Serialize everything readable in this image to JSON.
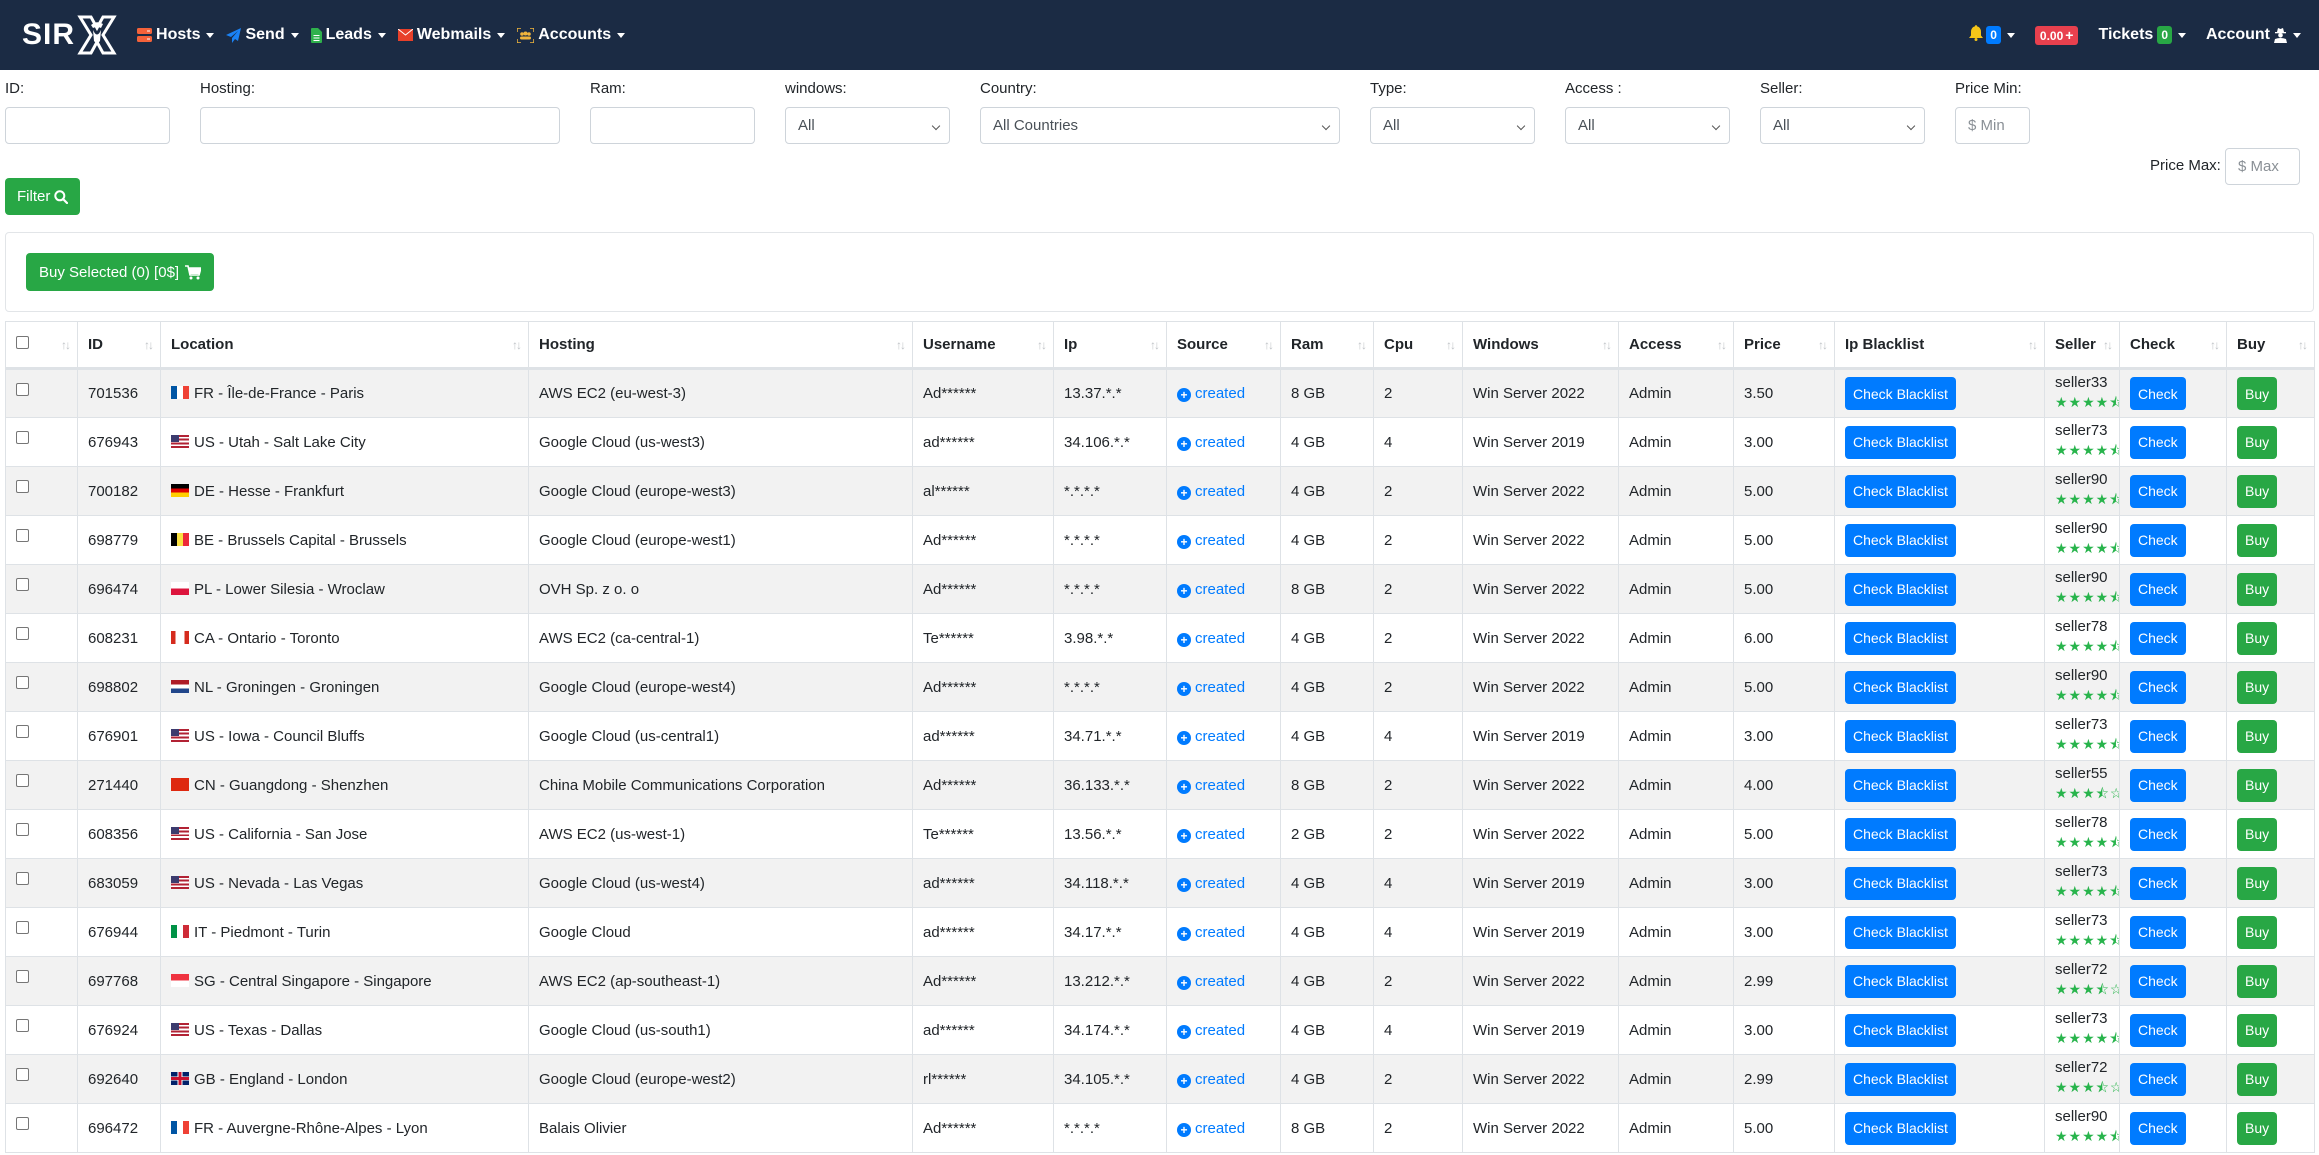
{
  "navbar": {
    "brand": "SIR",
    "menu": [
      {
        "label": "Hosts",
        "icon": "server-icon",
        "color": "#f4623a"
      },
      {
        "label": "Send",
        "icon": "paper-plane-icon",
        "color": "#1a82f5"
      },
      {
        "label": "Leads",
        "icon": "document-icon",
        "color": "#2fb14c"
      },
      {
        "label": "Webmails",
        "icon": "envelope-icon",
        "color": "#e8402a"
      },
      {
        "label": "Accounts",
        "icon": "users-icon",
        "color": "#f0b43c"
      }
    ],
    "notifications_count": "0",
    "balance": "0.00",
    "tickets_label": "Tickets",
    "tickets_count": "0",
    "account_label": "Account"
  },
  "filters": {
    "id": {
      "label": "ID:",
      "value": ""
    },
    "hosting": {
      "label": "Hosting:",
      "value": ""
    },
    "ram": {
      "label": "Ram:",
      "value": ""
    },
    "windows": {
      "label": "windows:",
      "selected": "All"
    },
    "country": {
      "label": "Country:",
      "selected": "All Countries"
    },
    "type": {
      "label": "Type:",
      "selected": "All"
    },
    "access": {
      "label": "Access :",
      "selected": "All"
    },
    "seller": {
      "label": "Seller:",
      "selected": "All"
    },
    "price_min": {
      "label": "Price Min:",
      "placeholder": "$ Min"
    },
    "price_max": {
      "label": "Price Max:",
      "placeholder": "$ Max"
    },
    "filter_button": "Filter"
  },
  "buy_selected": {
    "label": "Buy Selected (0) [0$]"
  },
  "table": {
    "columns": [
      "ID",
      "Location",
      "Hosting",
      "Username",
      "Ip",
      "Source",
      "Ram",
      "Cpu",
      "Windows",
      "Access",
      "Price",
      "Ip Blacklist",
      "Seller",
      "Check",
      "Buy"
    ],
    "check_blacklist_label": "Check Blacklist",
    "check_label": "Check",
    "buy_label": "Buy",
    "rows": [
      {
        "id": "701536",
        "flag": "FR",
        "location": "FR - Île-de-France - Paris",
        "hosting": "AWS EC2 (eu-west-3)",
        "username": "Ad******",
        "ip": "13.37.*.*",
        "source": "created",
        "ram": "8 GB",
        "cpu": "2",
        "windows": "Win Server 2022",
        "access": "Admin",
        "price": "3.50",
        "seller": "seller33",
        "rating": 4.5
      },
      {
        "id": "676943",
        "flag": "US",
        "location": "US - Utah - Salt Lake City",
        "hosting": "Google Cloud (us-west3)",
        "username": "ad******",
        "ip": "34.106.*.*",
        "source": "created",
        "ram": "4 GB",
        "cpu": "4",
        "windows": "Win Server 2019",
        "access": "Admin",
        "price": "3.00",
        "seller": "seller73",
        "rating": 4.5
      },
      {
        "id": "700182",
        "flag": "DE",
        "location": "DE - Hesse - Frankfurt",
        "hosting": "Google Cloud (europe-west3)",
        "username": "al******",
        "ip": "*.*.*.*",
        "source": "created",
        "ram": "4 GB",
        "cpu": "2",
        "windows": "Win Server 2022",
        "access": "Admin",
        "price": "5.00",
        "seller": "seller90",
        "rating": 4.5
      },
      {
        "id": "698779",
        "flag": "BE",
        "location": "BE - Brussels Capital - Brussels",
        "hosting": "Google Cloud (europe-west1)",
        "username": "Ad******",
        "ip": "*.*.*.*",
        "source": "created",
        "ram": "4 GB",
        "cpu": "2",
        "windows": "Win Server 2022",
        "access": "Admin",
        "price": "5.00",
        "seller": "seller90",
        "rating": 4.5
      },
      {
        "id": "696474",
        "flag": "PL",
        "location": "PL - Lower Silesia - Wroclaw",
        "hosting": "OVH Sp. z o. o",
        "username": "Ad******",
        "ip": "*.*.*.*",
        "source": "created",
        "ram": "8 GB",
        "cpu": "2",
        "windows": "Win Server 2022",
        "access": "Admin",
        "price": "5.00",
        "seller": "seller90",
        "rating": 4.5
      },
      {
        "id": "608231",
        "flag": "CA",
        "location": "CA - Ontario - Toronto",
        "hosting": "AWS EC2 (ca-central-1)",
        "username": "Te******",
        "ip": "3.98.*.*",
        "source": "created",
        "ram": "4 GB",
        "cpu": "2",
        "windows": "Win Server 2022",
        "access": "Admin",
        "price": "6.00",
        "seller": "seller78",
        "rating": 4.5
      },
      {
        "id": "698802",
        "flag": "NL",
        "location": "NL - Groningen - Groningen",
        "hosting": "Google Cloud (europe-west4)",
        "username": "Ad******",
        "ip": "*.*.*.*",
        "source": "created",
        "ram": "4 GB",
        "cpu": "2",
        "windows": "Win Server 2022",
        "access": "Admin",
        "price": "5.00",
        "seller": "seller90",
        "rating": 4.5
      },
      {
        "id": "676901",
        "flag": "US",
        "location": "US - Iowa - Council Bluffs",
        "hosting": "Google Cloud (us-central1)",
        "username": "ad******",
        "ip": "34.71.*.*",
        "source": "created",
        "ram": "4 GB",
        "cpu": "4",
        "windows": "Win Server 2019",
        "access": "Admin",
        "price": "3.00",
        "seller": "seller73",
        "rating": 4.5
      },
      {
        "id": "271440",
        "flag": "CN",
        "location": "CN - Guangdong - Shenzhen",
        "hosting": "China Mobile Communications Corporation",
        "username": "Ad******",
        "ip": "36.133.*.*",
        "source": "created",
        "ram": "8 GB",
        "cpu": "2",
        "windows": "Win Server 2022",
        "access": "Admin",
        "price": "4.00",
        "seller": "seller55",
        "rating": 3.5
      },
      {
        "id": "608356",
        "flag": "US",
        "location": "US - California - San Jose",
        "hosting": "AWS EC2 (us-west-1)",
        "username": "Te******",
        "ip": "13.56.*.*",
        "source": "created",
        "ram": "2 GB",
        "cpu": "2",
        "windows": "Win Server 2022",
        "access": "Admin",
        "price": "5.00",
        "seller": "seller78",
        "rating": 4.5
      },
      {
        "id": "683059",
        "flag": "US",
        "location": "US - Nevada - Las Vegas",
        "hosting": "Google Cloud (us-west4)",
        "username": "ad******",
        "ip": "34.118.*.*",
        "source": "created",
        "ram": "4 GB",
        "cpu": "4",
        "windows": "Win Server 2019",
        "access": "Admin",
        "price": "3.00",
        "seller": "seller73",
        "rating": 4.5
      },
      {
        "id": "676944",
        "flag": "IT",
        "location": "IT - Piedmont - Turin",
        "hosting": "Google Cloud",
        "username": "ad******",
        "ip": "34.17.*.*",
        "source": "created",
        "ram": "4 GB",
        "cpu": "4",
        "windows": "Win Server 2019",
        "access": "Admin",
        "price": "3.00",
        "seller": "seller73",
        "rating": 4.5
      },
      {
        "id": "697768",
        "flag": "SG",
        "location": "SG - Central Singapore - Singapore",
        "hosting": "AWS EC2 (ap-southeast-1)",
        "username": "Ad******",
        "ip": "13.212.*.*",
        "source": "created",
        "ram": "4 GB",
        "cpu": "2",
        "windows": "Win Server 2022",
        "access": "Admin",
        "price": "2.99",
        "seller": "seller72",
        "rating": 3.5
      },
      {
        "id": "676924",
        "flag": "US",
        "location": "US - Texas - Dallas",
        "hosting": "Google Cloud (us-south1)",
        "username": "ad******",
        "ip": "34.174.*.*",
        "source": "created",
        "ram": "4 GB",
        "cpu": "4",
        "windows": "Win Server 2019",
        "access": "Admin",
        "price": "3.00",
        "seller": "seller73",
        "rating": 4.5
      },
      {
        "id": "692640",
        "flag": "GB",
        "location": "GB - England - London",
        "hosting": "Google Cloud (europe-west2)",
        "username": "rl******",
        "ip": "34.105.*.*",
        "source": "created",
        "ram": "4 GB",
        "cpu": "2",
        "windows": "Win Server 2022",
        "access": "Admin",
        "price": "2.99",
        "seller": "seller72",
        "rating": 3.5
      },
      {
        "id": "696472",
        "flag": "FR",
        "location": "FR - Auvergne-Rhône-Alpes - Lyon",
        "hosting": "Balais Olivier",
        "username": "Ad******",
        "ip": "*.*.*.*",
        "source": "created",
        "ram": "8 GB",
        "cpu": "2",
        "windows": "Win Server 2022",
        "access": "Admin",
        "price": "5.00",
        "seller": "seller90",
        "rating": 4.5
      }
    ]
  }
}
